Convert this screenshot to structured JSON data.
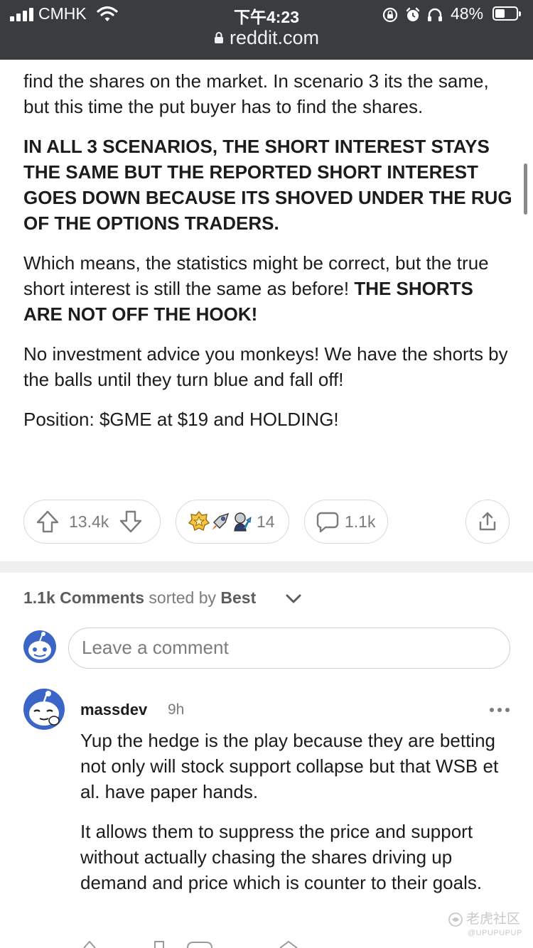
{
  "status_bar": {
    "carrier": "CMHK",
    "time": "下午4:23",
    "battery": "48%",
    "battery_level": 0.48
  },
  "browser": {
    "url": "reddit.com"
  },
  "post": {
    "paragraphs": {
      "p1": "find the shares on the market. In scenario 3 its the same, but this time the put buyer has to find the shares.",
      "p2": "IN ALL 3 SCENARIOS, THE SHORT INTEREST STAYS THE SAME BUT THE REPORTED SHORT INTEREST GOES DOWN BECAUSE ITS SHOVED UNDER THE RUG OF THE OPTIONS TRADERS.",
      "p3_normal": "Which means, the statistics might be correct, but the true short interest is still the same as before! ",
      "p3_bold": "THE SHORTS ARE NOT OFF THE HOOK!",
      "p4": "No investment advice you monkeys! We have the shorts by the balls until they turn blue and fall off!",
      "p5": "Position: $GME at $19 and HOLDING!"
    },
    "actions": {
      "vote_count": "13.4k",
      "awards_count": "14",
      "comments_count": "1.1k"
    }
  },
  "comments_section": {
    "count_label": "1.1k Comments",
    "sorted_by": "sorted by",
    "sort_value": "Best",
    "input_placeholder": "Leave a comment"
  },
  "comment": {
    "author": "massdev",
    "time": "9h",
    "paragraphs": [
      "Yup the hedge is the play because they are betting not only will stock support collapse but that WSB et al. have paper hands.",
      "It allows them to suppress the price and support without actually chasing the shares driving up demand and price which is counter to their goals."
    ]
  },
  "watermark": {
    "text": "老虎社区",
    "handle": "@UPUPUPUP"
  },
  "colors": {
    "topbar": "#3a3d40",
    "muted_text": "#7c7c7c",
    "divider": "#edeff1",
    "snoo_blue": "#3b66c8"
  }
}
